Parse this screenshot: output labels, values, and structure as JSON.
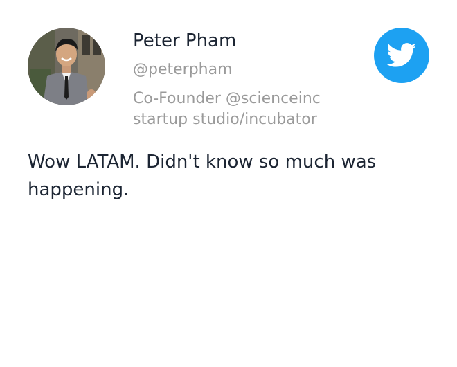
{
  "author": {
    "name": "Peter Pham",
    "handle": "@peterpham",
    "bio": "Co-Founder @scienceinc startup studio/incubator",
    "avatar_icon": "profile-photo"
  },
  "badge": {
    "icon": "twitter-bird-icon",
    "color": "#1da1f2"
  },
  "tweet": {
    "text": "Wow LATAM. Didn't know so much was happening."
  },
  "colors": {
    "primary_text": "#1c2533",
    "secondary_text": "#9a9a9a"
  }
}
